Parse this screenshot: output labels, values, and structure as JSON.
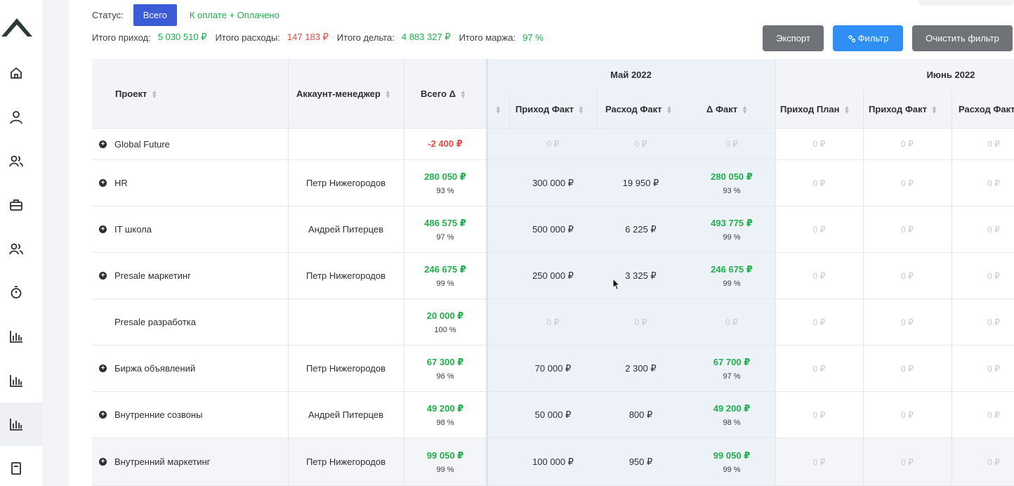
{
  "sidebar": {
    "icons": [
      "home-icon",
      "user-icon",
      "users-icon",
      "briefcase-icon",
      "team-icon",
      "stopwatch-icon",
      "bar-chart-icon",
      "bar-chart-icon",
      "bar-chart-icon",
      "document-icon"
    ]
  },
  "status": {
    "label": "Статус:",
    "all_button": "Всего",
    "paid_link": "К оплате + Оплачено"
  },
  "totals": {
    "income_label": "Итого приход:",
    "income_value": "5 030 510 ₽",
    "expense_label": "Итого расходы:",
    "expense_value": "147 183 ₽",
    "delta_label": "Итого дельта:",
    "delta_value": "4 883 327 ₽",
    "margin_label": "Итого маржа:",
    "margin_value": "97 %"
  },
  "toolbar": {
    "export_label": "Экспорт",
    "filter_label": "Фильтр",
    "clear_label": "Очистить фильтр"
  },
  "table": {
    "headers": {
      "project": "Проект",
      "manager": "Аккаунт-менеджер",
      "total": "Всего Δ",
      "may": "Май 2022",
      "june": "Июнь 2022",
      "may_income_fact": "Приход Факт",
      "may_expense_fact": "Расход Факт",
      "may_delta_fact": "Δ Факт",
      "jun_income_plan": "Приход План",
      "jun_income_fact": "Приход Факт",
      "jun_expense_fact": "Расход Факт"
    },
    "zero": "0 ₽",
    "rows": [
      {
        "project": "Global Future",
        "expandable": true,
        "manager": "",
        "total": "-2 400 ₽",
        "total_pct": "",
        "total_color": "red",
        "may_income": "0 ₽",
        "may_expense": "0 ₽",
        "may_delta": "0 ₽",
        "may_delta_pct": "",
        "highlight": false
      },
      {
        "project": "HR",
        "expandable": true,
        "manager": "Петр Нижегородов",
        "total": "280 050 ₽",
        "total_pct": "93 %",
        "total_color": "green",
        "may_income": "300 000 ₽",
        "may_expense": "19 950 ₽",
        "may_delta": "280 050 ₽",
        "may_delta_pct": "93 %",
        "highlight": false
      },
      {
        "project": "IT школа",
        "expandable": true,
        "manager": "Андрей Питерцев",
        "total": "486 575 ₽",
        "total_pct": "97 %",
        "total_color": "green",
        "may_income": "500 000 ₽",
        "may_expense": "6 225 ₽",
        "may_delta": "493 775 ₽",
        "may_delta_pct": "99 %",
        "highlight": false
      },
      {
        "project": "Presale маркетинг",
        "expandable": true,
        "manager": "Петр Нижегородов",
        "total": "246 675 ₽",
        "total_pct": "99 %",
        "total_color": "green",
        "may_income": "250 000 ₽",
        "may_expense": "3 325 ₽",
        "may_delta": "246 675 ₽",
        "may_delta_pct": "99 %",
        "highlight": false
      },
      {
        "project": "Presale разработка",
        "expandable": false,
        "manager": "",
        "total": "20 000 ₽",
        "total_pct": "100 %",
        "total_color": "green",
        "may_income": "0 ₽",
        "may_expense": "0 ₽",
        "may_delta": "0 ₽",
        "may_delta_pct": "",
        "highlight": false
      },
      {
        "project": "Биржа объявлений",
        "expandable": true,
        "manager": "Петр Нижегородов",
        "total": "67 300 ₽",
        "total_pct": "96 %",
        "total_color": "green",
        "may_income": "70 000 ₽",
        "may_expense": "2 300 ₽",
        "may_delta": "67 700 ₽",
        "may_delta_pct": "97 %",
        "highlight": false
      },
      {
        "project": "Внутренние созвоны",
        "expandable": true,
        "manager": "Андрей Питерцев",
        "total": "49 200 ₽",
        "total_pct": "98 %",
        "total_color": "green",
        "may_income": "50 000 ₽",
        "may_expense": "800 ₽",
        "may_delta": "49 200 ₽",
        "may_delta_pct": "98 %",
        "highlight": false
      },
      {
        "project": "Внутренний маркетинг",
        "expandable": true,
        "manager": "Петр Нижегородов",
        "total": "99 050 ₽",
        "total_pct": "99 %",
        "total_color": "green",
        "may_income": "100 000 ₽",
        "may_expense": "950 ₽",
        "may_delta": "99 050 ₽",
        "may_delta_pct": "99 %",
        "highlight": true
      }
    ]
  },
  "colors": {
    "primary_button": "#3c5bd6",
    "filter_button": "#2f8ff5",
    "gray_button": "#6f7277",
    "positive": "#1fae4b",
    "negative": "#e04b4b"
  }
}
